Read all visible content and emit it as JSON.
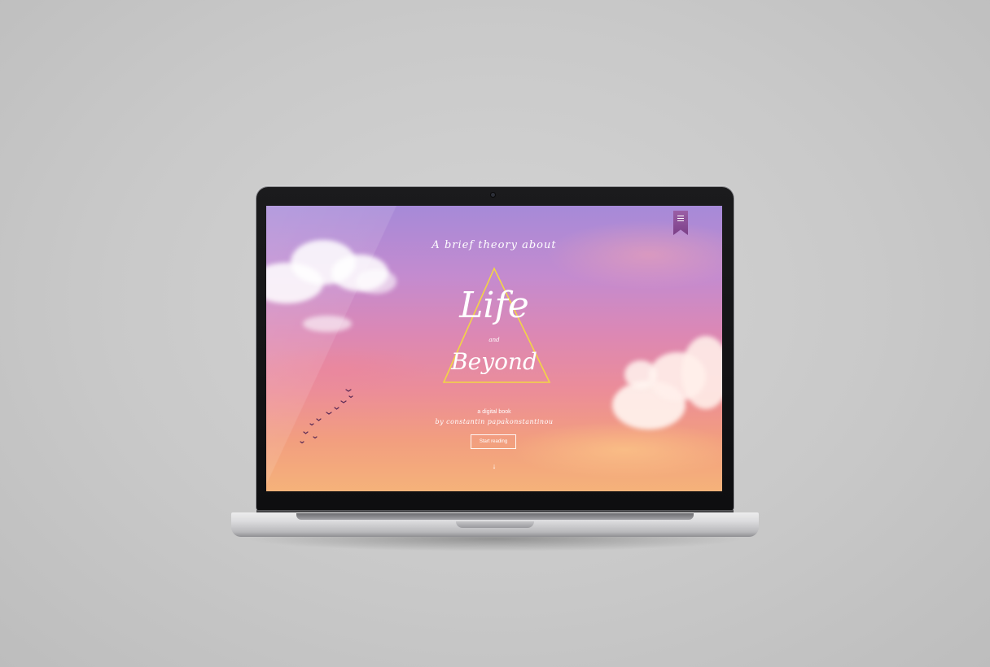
{
  "device": "laptop",
  "screen": {
    "menu": {
      "icon": "bookmark-menu-icon",
      "color": "#8a4b96"
    },
    "hero": {
      "subtitle": "A brief theory about",
      "title_line1": "Life",
      "title_connector": "and",
      "title_line2": "Beyond",
      "tagline": "a digital book",
      "author": "by constantin papakonstantinou",
      "cta_label": "Start reading",
      "scroll_glyph": "↓"
    },
    "colors": {
      "triangle": "#f2d545",
      "text": "#ffffff",
      "sky_top": "#a68ad8",
      "sky_bottom": "#f5b27a"
    }
  }
}
